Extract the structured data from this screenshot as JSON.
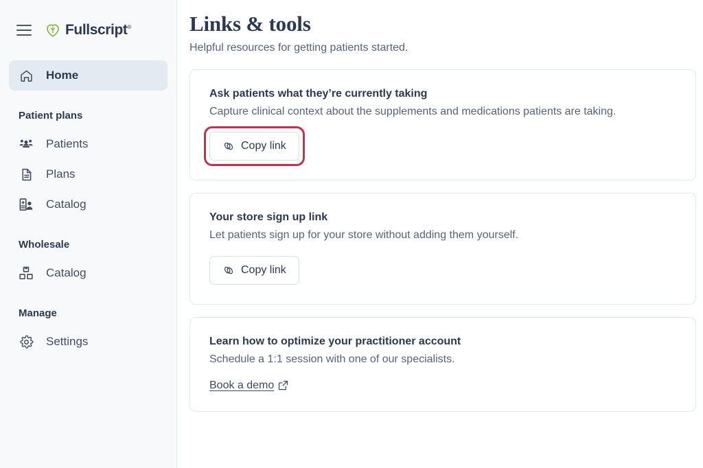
{
  "brand": {
    "name": "Fullscript",
    "trademark": "®",
    "logo_color": "#8cba4e",
    "wordmark_color": "#2b3a52"
  },
  "sidebar": {
    "menu_icon": "hamburger-icon",
    "primary": [
      {
        "label": "Home",
        "icon": "home-icon",
        "active": true
      }
    ],
    "groups": [
      {
        "title": "Patient plans",
        "items": [
          {
            "label": "Patients",
            "icon": "people-icon"
          },
          {
            "label": "Plans",
            "icon": "document-icon"
          },
          {
            "label": "Catalog",
            "icon": "catalog-person-icon"
          }
        ]
      },
      {
        "title": "Wholesale",
        "items": [
          {
            "label": "Catalog",
            "icon": "boxes-icon"
          }
        ]
      },
      {
        "title": "Manage",
        "items": [
          {
            "label": "Settings",
            "icon": "gear-icon"
          }
        ]
      }
    ]
  },
  "main": {
    "title": "Links & tools",
    "subtitle": "Helpful resources for getting patients started.",
    "cards": [
      {
        "title": "Ask patients what they’re currently taking",
        "description": "Capture clinical context about the supplements and medications patients are taking.",
        "action_label": "Copy link",
        "action_icon": "link-icon",
        "action_type": "button",
        "highlighted": true,
        "highlight_color": "#c62f4e"
      },
      {
        "title": "Your store sign up link",
        "description": "Let patients sign up for your store without adding them yourself.",
        "action_label": "Copy link",
        "action_icon": "link-icon",
        "action_type": "button",
        "highlighted": false
      },
      {
        "title": "Learn how to optimize your practitioner account",
        "description": "Schedule a 1:1 session with one of our specialists.",
        "action_label": "Book a demo",
        "action_icon": "external-link-icon",
        "action_type": "link",
        "highlighted": false
      }
    ]
  }
}
